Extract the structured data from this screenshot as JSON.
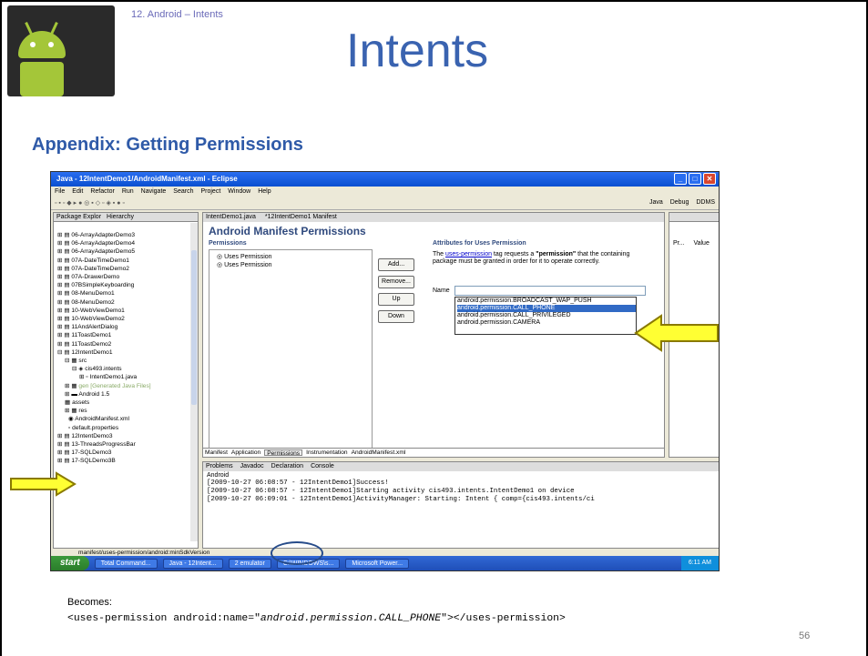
{
  "slide": {
    "subtitle": "12. Android – Intents",
    "title": "Intents",
    "section": "Appendix: Getting Permissions",
    "logo_text": "ANDROID",
    "becomes_label": "Becomes:",
    "code_pre": "<uses-permission android:name=\"",
    "code_italic": "android.permission.CALL_PHONE",
    "code_post": "\"></uses-permission>",
    "page_number": "56"
  },
  "eclipse": {
    "window_title": "Java - 12IntentDemo1/AndroidManifest.xml - Eclipse",
    "menu": [
      "File",
      "Edit",
      "Refactor",
      "Run",
      "Navigate",
      "Search",
      "Project",
      "Window",
      "Help"
    ],
    "perspectives": [
      "Java",
      "Debug",
      "DDMS"
    ],
    "left_tabs": [
      "Package Explor",
      "Hierarchy"
    ],
    "tree": [
      "06-ArrayAdapterDemo3",
      "06-ArrayAdapterDemo4",
      "06-ArrayAdapterDemo5",
      "07A-DateTimeDemo1",
      "07A-DateTimeDemo2",
      "07A-DrawerDemo",
      "07BSimpleKeyboarding",
      "08-MenuDemo1",
      "08-MenuDemo2",
      "10-WebViewDemo1",
      "10-WebViewDemo2",
      "11AndAlertDialog",
      "11ToastDemo1",
      "11ToastDemo2",
      "12IntentDemo1",
      "src",
      "cis493.intents",
      "IntentDemo1.java",
      "gen [Generated Java Files]",
      "Android 1.5",
      "assets",
      "res",
      "AndroidManifest.xml",
      "default.properties",
      "12IntentDemo3",
      "13-ThreadsProgressBar",
      "17-SQLDemo3",
      "17-SQLDemo3B"
    ],
    "editor_tabs": [
      "IntentDemo1.java",
      "*12IntentDemo1 Manifest"
    ],
    "manifest_title": "Android Manifest Permissions",
    "permissions_header": "Permissions",
    "permissions": [
      "Uses Permission",
      "Uses Permission"
    ],
    "buttons": [
      "Add...",
      "Remove...",
      "Up",
      "Down"
    ],
    "attributes_header": "Attributes for Uses Permission",
    "attr_desc_1": "The ",
    "attr_link": "uses-permission",
    "attr_desc_2": " tag requests a ",
    "attr_bold": "\"permission\"",
    "attr_desc_3": " that the containing package must be granted in order for it to operate correctly.",
    "name_label": "Name",
    "dropdown": [
      "android.permission.BROADCAST_WAP_PUSH",
      "android.permission.CALL_PHONE",
      "android.permission.CALL_PRIVILEGED",
      "android.permission.CAMERA"
    ],
    "selected_index": 1,
    "bottom_tabs": [
      "Manifest",
      "Application",
      "Permissions",
      "Instrumentation",
      "AndroidManifest.xml"
    ],
    "console_tabs": [
      "Problems",
      "Javadoc",
      "Declaration",
      "Console"
    ],
    "console_label": "Android",
    "console_lines": [
      "[2009-10-27 06:08:57 - 12IntentDemo1]Success!",
      "[2009-10-27 06:08:57 - 12IntentDemo1]Starting activity cis493.intents.IntentDemo1 on device",
      "[2009-10-27 06:09:01 - 12IntentDemo1]ActivityManager: Starting: Intent { comp={cis493.intents/ci"
    ],
    "right_cols": [
      "Pr...",
      "Value"
    ],
    "status": "manifest/uses-permission/android:minSdkVersion",
    "taskbar": {
      "start": "start",
      "tasks": [
        "Total Command...",
        "Java - 12Intent...",
        "2 emulator",
        "C:\\WINDOWS\\s...",
        "Microsoft Power..."
      ],
      "clock": "6:11 AM"
    }
  },
  "colors": {
    "title": "#3a63b0",
    "section": "#2f5aa8",
    "arrow": "#ffff33",
    "arrow_stroke": "#8a7a00"
  }
}
